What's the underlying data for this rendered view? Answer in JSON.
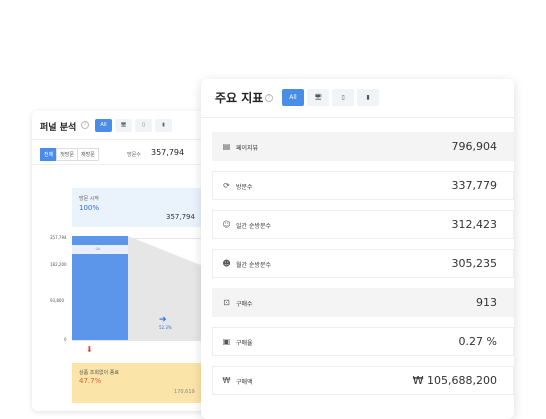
{
  "funnel": {
    "title": "퍼널 분석",
    "help": "?",
    "tabs": [
      "All",
      "🖥",
      "▯",
      "▮"
    ],
    "filters": [
      "전체",
      "첫방문",
      "재방문"
    ],
    "visitors_label": "방문수",
    "visitors_value": "357,794",
    "start_label": "방문 시작",
    "start_pct": "100%",
    "start_value": "357,794",
    "y_ticks": [
      "357,794",
      "182,200",
      "93,800",
      "0"
    ],
    "drop_pct": "52.3%",
    "step2_label": "상품 조회없이 종료",
    "step2_pct": "47.7%",
    "step2_value": "170,619"
  },
  "metrics": {
    "title": "주요 지표",
    "help": "?",
    "tabs": [
      "All",
      "🖥",
      "▯",
      "▮"
    ],
    "rows": [
      {
        "label": "페이지뷰",
        "value": "796,904",
        "icon": "page-icon"
      },
      {
        "label": "방문수",
        "value": "337,779",
        "icon": "visitor-icon"
      },
      {
        "label": "일간 순방문수",
        "value": "312,423",
        "icon": "daily-visitor-icon"
      },
      {
        "label": "월간 순방문수",
        "value": "305,235",
        "icon": "monthly-visitor-icon"
      },
      {
        "label": "구매수",
        "value": "913",
        "icon": "cart-icon"
      },
      {
        "label": "구매율",
        "value": "0.27 %",
        "icon": "rate-icon"
      },
      {
        "label": "구매액",
        "value": "₩ 105,688,200",
        "icon": "won-icon"
      }
    ]
  }
}
